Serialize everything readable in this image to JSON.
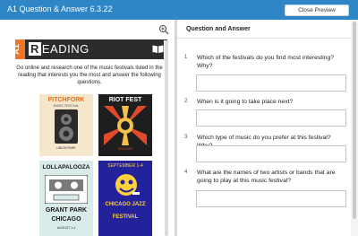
{
  "window": {
    "title": "A1 Question & Answer 6.3.22",
    "close_label": "Close Preview"
  },
  "worksheet": {
    "level": "A1",
    "banner_first_letter": "R",
    "banner_rest": "EADING",
    "instructions": "Go online and research one of the music festivals listed in the reading that interests you the most and answer the following questions.",
    "posters": {
      "pitchfork": {
        "name": "PITCHFORK",
        "sub": "MUSIC FESTIVAL",
        "bottom": "UNION PARK"
      },
      "riot_fest": {
        "name": "RIOT FEST",
        "sub": "CHICAGO"
      },
      "lollapalooza": {
        "name": "LOLLAPALOOZA",
        "line2": "GRANT PARK",
        "line3": "CHICAGO",
        "small": "AUGUST 1-4"
      },
      "jazz": {
        "name": "SEPTEMBER 1-4",
        "jazz": "CHICAGO JAZZ",
        "jazz2": "FESTIVAL"
      }
    }
  },
  "qa": {
    "heading": "Question and Answer",
    "questions": [
      {
        "num": "1",
        "text": "Which of the festivals do you find most interesting? Why?"
      },
      {
        "num": "2",
        "text": "When is it going to take place next?"
      },
      {
        "num": "3",
        "text": "Which type of music do you prefer at this festival? Why?"
      },
      {
        "num": "4",
        "text": "What are the names of two artists or bands that are going to play at this music festival?"
      }
    ]
  },
  "colors": {
    "topbar": "#2e86c7",
    "level_accent": "#ee7626",
    "banner": "#2c2c2c"
  },
  "icons": {
    "zoom": "zoom-in-icon",
    "book": "book-icon"
  }
}
